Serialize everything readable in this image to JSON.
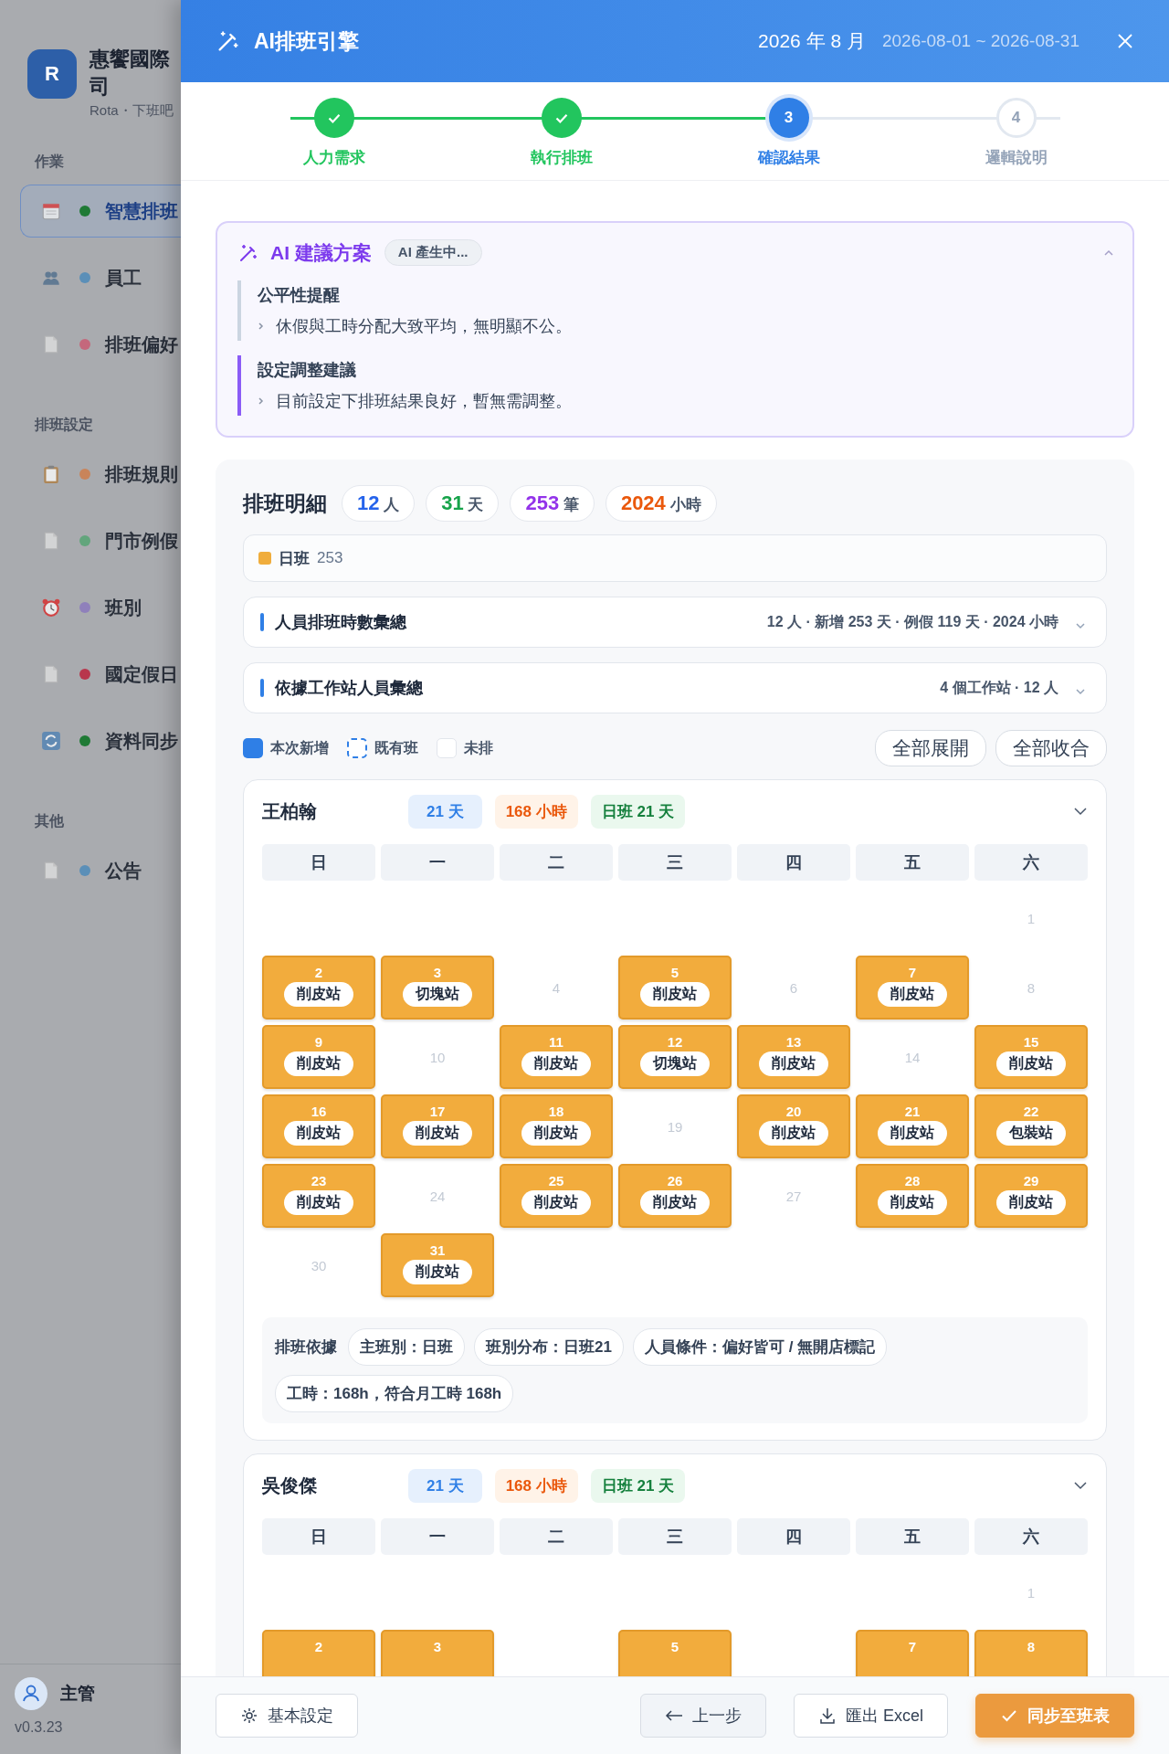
{
  "sidebar": {
    "brand": {
      "initial": "R",
      "name": "惠饗國際司",
      "subtitle": "Rota・下班吧"
    },
    "groups": [
      {
        "title": "作業",
        "items": [
          {
            "label": "智慧排班",
            "color": "#1f7a35",
            "selected": true
          },
          {
            "label": "員工",
            "color": "#5b8fb8",
            "selected": false
          },
          {
            "label": "排班偏好",
            "color": "#c4687c",
            "selected": false
          }
        ]
      },
      {
        "title": "排班設定",
        "items": [
          {
            "label": "排班規則",
            "color": "#c9845a",
            "selected": false
          },
          {
            "label": "門市例假",
            "color": "#62a57c",
            "selected": false
          },
          {
            "label": "班別",
            "color": "#8f80bb",
            "selected": false
          },
          {
            "label": "國定假日",
            "color": "#b8374d",
            "selected": false
          },
          {
            "label": "資料同步",
            "color": "#1f7a35",
            "selected": false
          }
        ]
      },
      {
        "title": "其他",
        "items": [
          {
            "label": "公告",
            "color": "#5b8fb8",
            "selected": false
          }
        ]
      }
    ],
    "user": {
      "name": "主管",
      "version": "v0.3.23"
    }
  },
  "modal": {
    "title": "AI排班引擎",
    "month": "2026 年 8 月",
    "range": "2026-08-01 ~ 2026-08-31",
    "steps": [
      {
        "label": "人力需求",
        "completed": true,
        "selected": false
      },
      {
        "label": "執行排班",
        "completed": true,
        "selected": false
      },
      {
        "label": "確認結果",
        "completed": false,
        "selected": true,
        "number": "3"
      },
      {
        "label": "邏輯說明",
        "completed": false,
        "selected": false,
        "number": "4"
      }
    ],
    "ai_card": {
      "title": "AI 建議方案",
      "badge": "AI 產生中...",
      "expanded": true,
      "sections": [
        {
          "title": "公平性提醒",
          "text": "休假與工時分配大致平均，無明顯不公。",
          "color": "#cbd5e1"
        },
        {
          "title": "設定調整建議",
          "text": "目前設定下排班結果良好，暫無需調整。",
          "color": "#8b5cf6"
        }
      ]
    },
    "detail": {
      "title": "排班明細",
      "stats": [
        {
          "value": "12",
          "unit": "人",
          "color": "#2563eb"
        },
        {
          "value": "31",
          "unit": "天",
          "color": "#16a34a"
        },
        {
          "value": "253",
          "unit": "筆",
          "color": "#9333ea"
        },
        {
          "value": "2024",
          "unit": "小時",
          "color": "#ea580c"
        }
      ],
      "shift": {
        "name": "日班",
        "count": "253",
        "color": "#f0ad3c"
      },
      "summaries": [
        {
          "title": "人員排班時數彙總",
          "info": "12 人 · 新增 253 天 · 例假 119 天 · 2024 小時",
          "expanded": false
        },
        {
          "title": "依據工作站人員彙總",
          "info": "4 個工作站 · 12 人",
          "expanded": false
        }
      ],
      "legend": [
        {
          "label": "本次新增",
          "kind": "new"
        },
        {
          "label": "既有班",
          "kind": "existing"
        },
        {
          "label": "未排",
          "kind": "none"
        }
      ],
      "actions": [
        "全部展開",
        "全部收合"
      ],
      "employees": [
        {
          "name": "王柏翰",
          "days": "21 天",
          "hours": "168 小時",
          "shift": "日班 21 天",
          "expanded": true,
          "weekdays": [
            "日",
            "一",
            "二",
            "三",
            "四",
            "五",
            "六"
          ],
          "cells": [
            {
              "kind": "blank"
            },
            {
              "kind": "blank"
            },
            {
              "kind": "blank"
            },
            {
              "kind": "blank"
            },
            {
              "kind": "blank"
            },
            {
              "kind": "blank"
            },
            {
              "kind": "off",
              "day": "1"
            },
            {
              "kind": "shift",
              "day": "2",
              "station": "削皮站"
            },
            {
              "kind": "shift",
              "day": "3",
              "station": "切塊站"
            },
            {
              "kind": "off",
              "day": "4"
            },
            {
              "kind": "shift",
              "day": "5",
              "station": "削皮站"
            },
            {
              "kind": "off",
              "day": "6"
            },
            {
              "kind": "shift",
              "day": "7",
              "station": "削皮站"
            },
            {
              "kind": "off",
              "day": "8"
            },
            {
              "kind": "shift",
              "day": "9",
              "station": "削皮站"
            },
            {
              "kind": "off",
              "day": "10"
            },
            {
              "kind": "shift",
              "day": "11",
              "station": "削皮站"
            },
            {
              "kind": "shift",
              "day": "12",
              "station": "切塊站"
            },
            {
              "kind": "shift",
              "day": "13",
              "station": "削皮站"
            },
            {
              "kind": "off",
              "day": "14"
            },
            {
              "kind": "shift",
              "day": "15",
              "station": "削皮站"
            },
            {
              "kind": "shift",
              "day": "16",
              "station": "削皮站"
            },
            {
              "kind": "shift",
              "day": "17",
              "station": "削皮站"
            },
            {
              "kind": "shift",
              "day": "18",
              "station": "削皮站"
            },
            {
              "kind": "off",
              "day": "19"
            },
            {
              "kind": "shift",
              "day": "20",
              "station": "削皮站"
            },
            {
              "kind": "shift",
              "day": "21",
              "station": "削皮站"
            },
            {
              "kind": "shift",
              "day": "22",
              "station": "包裝站"
            },
            {
              "kind": "shift",
              "day": "23",
              "station": "削皮站"
            },
            {
              "kind": "off",
              "day": "24"
            },
            {
              "kind": "shift",
              "day": "25",
              "station": "削皮站"
            },
            {
              "kind": "shift",
              "day": "26",
              "station": "削皮站"
            },
            {
              "kind": "off",
              "day": "27"
            },
            {
              "kind": "shift",
              "day": "28",
              "station": "削皮站"
            },
            {
              "kind": "shift",
              "day": "29",
              "station": "削皮站"
            },
            {
              "kind": "off",
              "day": "30"
            },
            {
              "kind": "shift",
              "day": "31",
              "station": "削皮站"
            }
          ],
          "basis": {
            "label": "排班依據",
            "tags": [
              "主班別：日班",
              "班別分布：日班21",
              "人員條件：偏好皆可 / 無開店標記",
              "工時：168h，符合月工時 168h"
            ]
          }
        },
        {
          "name": "吳俊傑",
          "days": "21 天",
          "hours": "168 小時",
          "shift": "日班 21 天",
          "expanded": true,
          "weekdays": [
            "日",
            "一",
            "二",
            "三",
            "四",
            "五",
            "六"
          ],
          "cells": [
            {
              "kind": "blank"
            },
            {
              "kind": "blank"
            },
            {
              "kind": "blank"
            },
            {
              "kind": "blank"
            },
            {
              "kind": "blank"
            },
            {
              "kind": "blank"
            },
            {
              "kind": "off",
              "day": "1"
            },
            {
              "kind": "shift",
              "day": "2"
            },
            {
              "kind": "shift",
              "day": "3"
            },
            {
              "kind": "blank"
            },
            {
              "kind": "shift",
              "day": "5"
            },
            {
              "kind": "blank"
            },
            {
              "kind": "shift",
              "day": "7"
            },
            {
              "kind": "shift",
              "day": "8"
            }
          ]
        }
      ]
    }
  },
  "footer": {
    "settings": "基本設定",
    "back": "上一步",
    "export": "匯出 Excel",
    "sync": "同步至班表"
  }
}
